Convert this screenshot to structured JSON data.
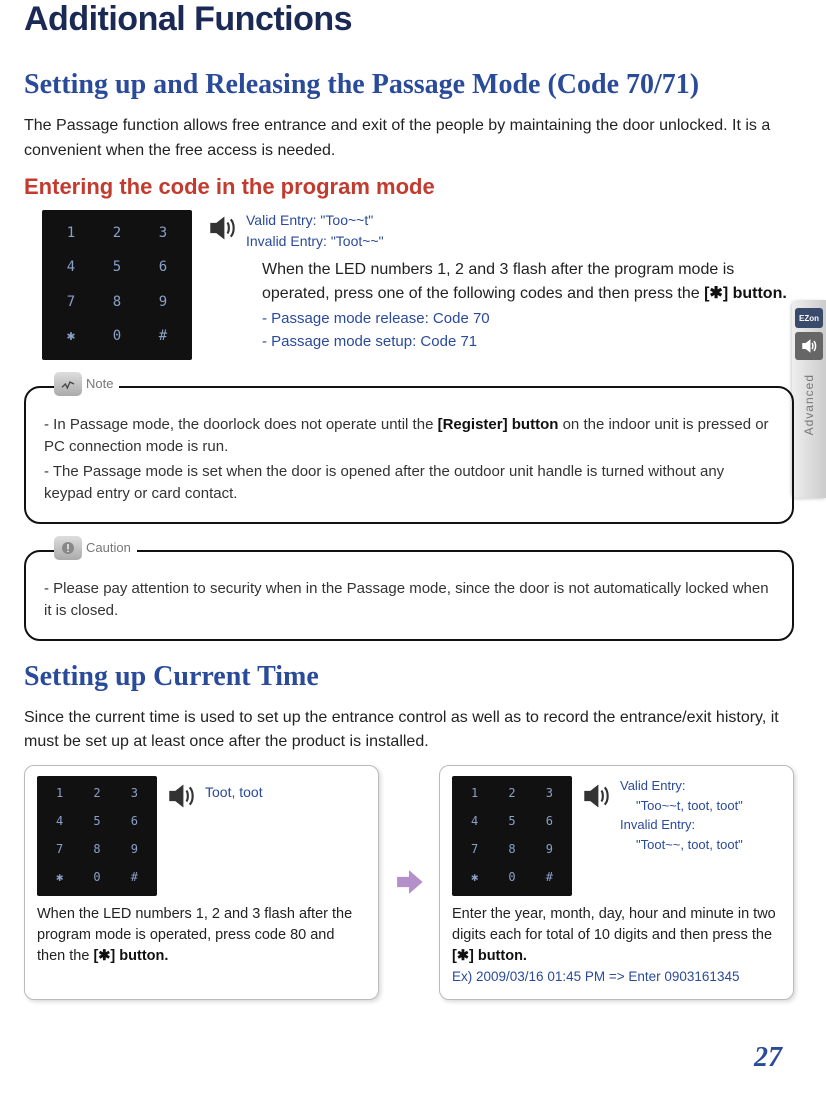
{
  "page": {
    "title": "Additional Functions",
    "number": "27"
  },
  "sideTab": {
    "brand": "EZon",
    "label": "Advanced"
  },
  "section1": {
    "title": "Setting up and Releasing the Passage Mode (Code 70/71)",
    "intro": "The Passage function allows free entrance and exit of the people by maintaining the door unlocked. It is a convenient when the free access is needed.",
    "subheading": "Entering the code in the program mode",
    "sound": {
      "valid": "Valid Entry: \"Too~~t\"",
      "invalid": "Invalid Entry: \"Toot~~\""
    },
    "body_line1": "When the LED numbers 1, 2 and 3 flash after the program mode is operated, press one of the following codes and then press the ",
    "body_button": "[✱] button.",
    "code1": "- Passage mode release: Code 70",
    "code2": "- Passage mode setup: Code 71",
    "note": {
      "label": "Note",
      "l1_a": "- In Passage mode, the doorlock does not operate until the ",
      "l1_bold": "[Register] button",
      "l1_b": " on the indoor unit is pressed or PC connection mode is run.",
      "l2": "- The Passage mode is set when the door is opened after the outdoor unit handle is turned without any keypad entry or card contact."
    },
    "caution": {
      "label": "Caution",
      "l1": "- Please pay attention to security when in the Passage mode, since the door is not automatically locked when it is closed."
    }
  },
  "section2": {
    "title": "Setting up Current Time",
    "intro": "Since the current time is used to set up the entrance control as well as to record the entrance/exit history, it must be set up at least once after the product is installed.",
    "step1": {
      "sound": "Toot, toot",
      "text_a": "When the LED numbers 1, 2 and 3 flash after the program mode is operated, press code 80 and then the ",
      "text_button": "[✱] button."
    },
    "step2": {
      "valid_label": "Valid Entry:",
      "valid_val": "\"Too~~t, toot, toot\"",
      "invalid_label": "Invalid Entry:",
      "invalid_val": "\"Toot~~, toot, toot\"",
      "text_a": "Enter the year, month, day, hour and minute in two digits each for total of 10 digits and then press the ",
      "text_button": "[✱] button.",
      "example": "Ex) 2009/03/16 01:45 PM => Enter 0903161345"
    }
  },
  "keypad": {
    "keys": [
      "1",
      "2",
      "3",
      "4",
      "5",
      "6",
      "7",
      "8",
      "9",
      "✱",
      "0",
      "#"
    ]
  }
}
